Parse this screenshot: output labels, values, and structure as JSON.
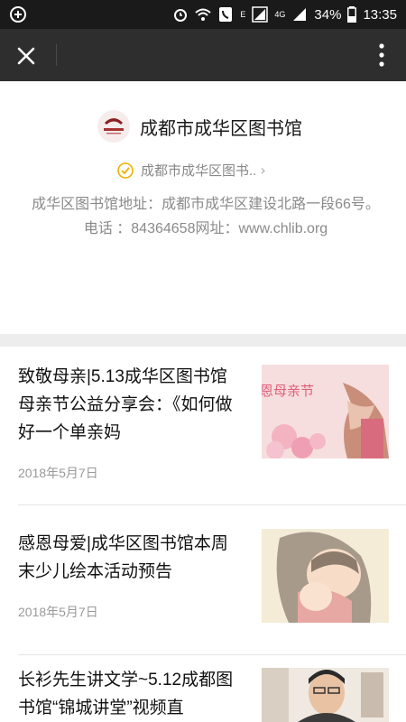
{
  "statusbar": {
    "battery": "34%",
    "time": "13:35",
    "network": "4G",
    "e_label": "E"
  },
  "account": {
    "name": "成都市成华区图书馆",
    "verified_name": "成都市成华区图书..",
    "description": "成华区图书馆地址：成都市成华区建设北路一段66号。电话 ：84364658网址：www.chlib.org"
  },
  "articles": [
    {
      "title": "致敬母亲|5.13成华区图书馆母亲节公益分享会：《如何做好一个单亲妈",
      "date": "2018年5月7日",
      "thumb_text": "恩母亲节"
    },
    {
      "title": "感恩母爱|成华区图书馆本周末少儿绘本活动预告",
      "date": "2018年5月7日"
    },
    {
      "title": "长衫先生讲文学~5.12成都图书馆“锦城讲堂”视频直",
      "date": ""
    }
  ],
  "colors": {
    "navbar": "#2e2e2e",
    "statusbar": "#1a1a1a",
    "verify": "#f0b000"
  }
}
